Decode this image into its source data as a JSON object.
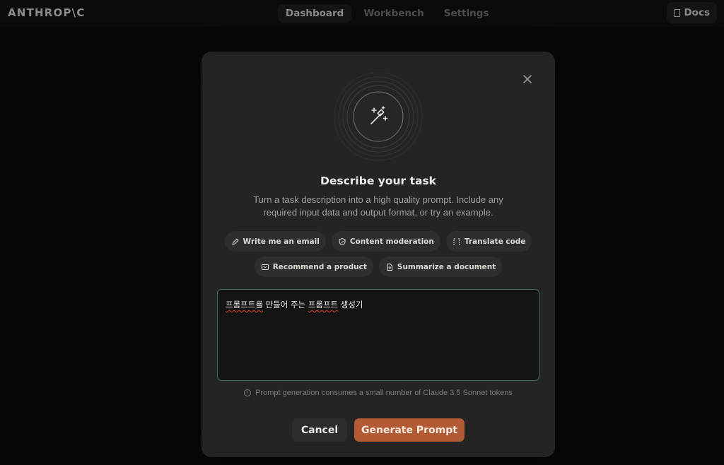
{
  "app": {
    "logo_text": "ANTHROP\\C"
  },
  "nav": {
    "items": [
      {
        "label": "Dashboard",
        "active": true
      },
      {
        "label": "Workbench",
        "active": false
      },
      {
        "label": "Settings",
        "active": false
      }
    ],
    "docs_label": "Docs"
  },
  "modal": {
    "title": "Describe your task",
    "subtitle": "Turn a task description into a high quality prompt. Include any required input data and output format, or try an example.",
    "examples": [
      {
        "label": "Write me an email",
        "icon": "pen-icon"
      },
      {
        "label": "Content moderation",
        "icon": "shield-icon"
      },
      {
        "label": "Translate code",
        "icon": "code-bracket-icon"
      },
      {
        "label": "Recommend a product",
        "icon": "product-box-icon"
      },
      {
        "label": "Summarize a document",
        "icon": "document-icon"
      }
    ],
    "textarea_value": {
      "part1": "프롬프트를",
      "part2": " 만들어 주는 ",
      "part3": "프롬프트",
      "part4": " 생성기"
    },
    "note": "Prompt generation consumes a small number of Claude 3.5 Sonnet tokens",
    "cancel_label": "Cancel",
    "generate_label": "Generate Prompt",
    "hero_icon": "magic-wand-icon",
    "close_icon": "close-icon"
  },
  "colors": {
    "accent": "#b25a33",
    "focus_border": "#3e6c55",
    "modal_bg": "#242424"
  }
}
